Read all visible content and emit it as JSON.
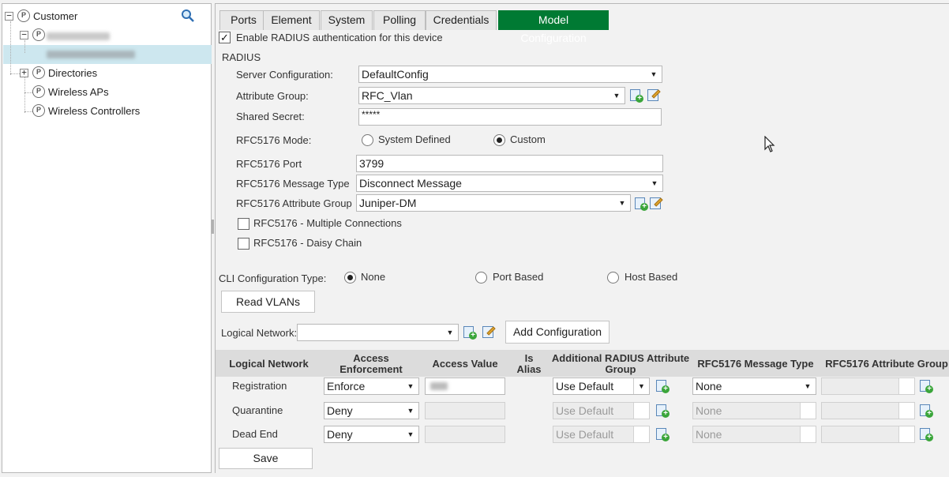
{
  "tree": {
    "root_label": "Customer",
    "items": [
      {
        "label": "Directories"
      },
      {
        "label": "Wireless APs"
      },
      {
        "label": "Wireless Controllers"
      }
    ]
  },
  "tabs": [
    "Ports",
    "Element",
    "System",
    "Polling",
    "Credentials",
    "Model Configuration"
  ],
  "active_tab": "Model Configuration",
  "enable_radius": {
    "label": "Enable RADIUS authentication for this device",
    "checked": true
  },
  "radius": {
    "section_title": "RADIUS",
    "server_config_label": "Server Configuration:",
    "server_config_value": "DefaultConfig",
    "attr_group_label": "Attribute Group:",
    "attr_group_value": "RFC_Vlan",
    "shared_secret_label": "Shared Secret:",
    "shared_secret_value": "*****",
    "rfc_mode_label": "RFC5176 Mode:",
    "rfc_mode_opt_system": "System Defined",
    "rfc_mode_opt_custom": "Custom",
    "rfc_mode_selected": "Custom",
    "rfc_port_label": "RFC5176 Port",
    "rfc_port_value": "3799",
    "rfc_msg_type_label": "RFC5176 Message Type",
    "rfc_msg_type_value": "Disconnect Message",
    "rfc_attr_group_label": "RFC5176 Attribute Group",
    "rfc_attr_group_value": "Juniper-DM",
    "multi_conn_label": "RFC5176 - Multiple Connections",
    "daisy_chain_label": "RFC5176 - Daisy Chain"
  },
  "cli": {
    "label": "CLI Configuration Type:",
    "opt_none": "None",
    "opt_port": "Port Based",
    "opt_host": "Host Based",
    "selected": "None"
  },
  "read_vlans_label": "Read VLANs",
  "logical_network": {
    "label": "Logical Network:",
    "value": "",
    "add_config_label": "Add Configuration"
  },
  "table": {
    "headers": {
      "logical_network": "Logical Network",
      "access_enforcement": "Access Enforcement",
      "access_value": "Access Value",
      "is_alias": "Is Alias",
      "additional_radius": "Additional RADIUS Attribute Group",
      "rfc_msg_type": "RFC5176 Message Type",
      "rfc_attr_group": "RFC5176 Attribute Group"
    },
    "rows": [
      {
        "name": "Registration",
        "enforcement": "Enforce",
        "radius_group": "Use Default",
        "msg_type": "None",
        "enabled": true
      },
      {
        "name": "Quarantine",
        "enforcement": "Deny",
        "radius_group": "Use Default",
        "msg_type": "None",
        "enabled": false
      },
      {
        "name": "Dead End",
        "enforcement": "Deny",
        "radius_group": "Use Default",
        "msg_type": "None",
        "enabled": false
      }
    ]
  },
  "save_label": "Save",
  "icons": [
    "search-icon",
    "add-icon",
    "edit-icon",
    "policy-icon"
  ],
  "colors": {
    "active_tab": "#007a33",
    "selected_row": "#cde7ef"
  }
}
